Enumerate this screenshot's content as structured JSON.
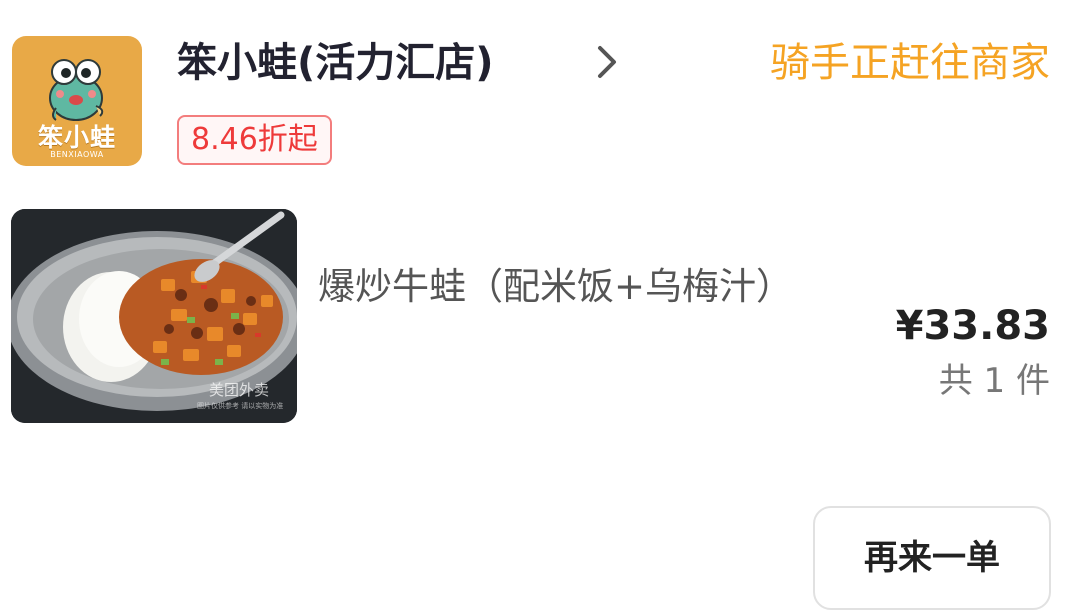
{
  "store": {
    "logo_text": "笨小蛙",
    "logo_subtext": "BENXIAOWA",
    "name": "笨小蛙(活力汇店)",
    "discount": "8.46折起"
  },
  "order": {
    "status": "骑手正赶往商家",
    "item": {
      "name": "爆炒牛蛙（配米饭+乌梅汁）",
      "image_watermark": "美团外卖",
      "image_watermark_note": "图片仅供参考 请以实物为准"
    },
    "price": "¥33.83",
    "quantity": "共 1 件",
    "reorder_label": "再来一单"
  },
  "colors": {
    "status": "#f5a323",
    "discount": "#ee3a3a",
    "logo_bg": "#e8a947"
  },
  "icons": {
    "chevron": "chevron-right-icon"
  }
}
